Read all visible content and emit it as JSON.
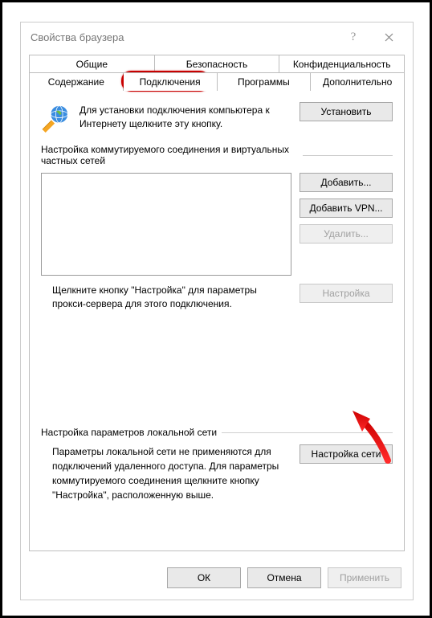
{
  "window": {
    "title": "Свойства браузера"
  },
  "tabs": {
    "row1": [
      "Общие",
      "Безопасность",
      "Конфиденциальность"
    ],
    "row2": [
      "Содержание",
      "Подключения",
      "Программы",
      "Дополнительно"
    ],
    "active": "Подключения"
  },
  "setup": {
    "text": "Для установки подключения компьютера к Интернету щелкните эту кнопку.",
    "button": "Установить"
  },
  "dialup": {
    "header": "Настройка коммутируемого соединения и виртуальных частных сетей",
    "buttons": {
      "add": "Добавить...",
      "add_vpn": "Добавить VPN...",
      "remove": "Удалить..."
    },
    "proxy_text": "Щелкните кнопку \"Настройка\" для параметры прокси-сервера для этого подключения.",
    "settings_btn": "Настройка"
  },
  "lan": {
    "header": "Настройка параметров локальной сети",
    "text": "Параметры локальной сети не применяются для подключений удаленного доступа. Для параметры коммутируемого соединения щелкните кнопку \"Настройка\", расположенную выше.",
    "button": "Настройка сети"
  },
  "footer": {
    "ok": "ОК",
    "cancel": "Отмена",
    "apply": "Применить"
  }
}
